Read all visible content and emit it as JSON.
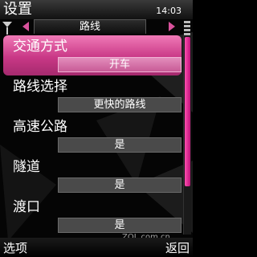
{
  "header": {
    "title": "设置",
    "clock": "14:03"
  },
  "tabs": {
    "current": "路线"
  },
  "settings": [
    {
      "label": "交通方式",
      "value": "开车"
    },
    {
      "label": "路线选择",
      "value": "更快的路线"
    },
    {
      "label": "高速公路",
      "value": "是"
    },
    {
      "label": "隧道",
      "value": "是"
    },
    {
      "label": "渡口",
      "value": "是"
    }
  ],
  "selected_index": 0,
  "softkeys": {
    "left": "选项",
    "right": "返回"
  },
  "watermark": "ZOL.com.cn",
  "colors": {
    "accent": "#d9529c",
    "selection": "#c93886"
  }
}
